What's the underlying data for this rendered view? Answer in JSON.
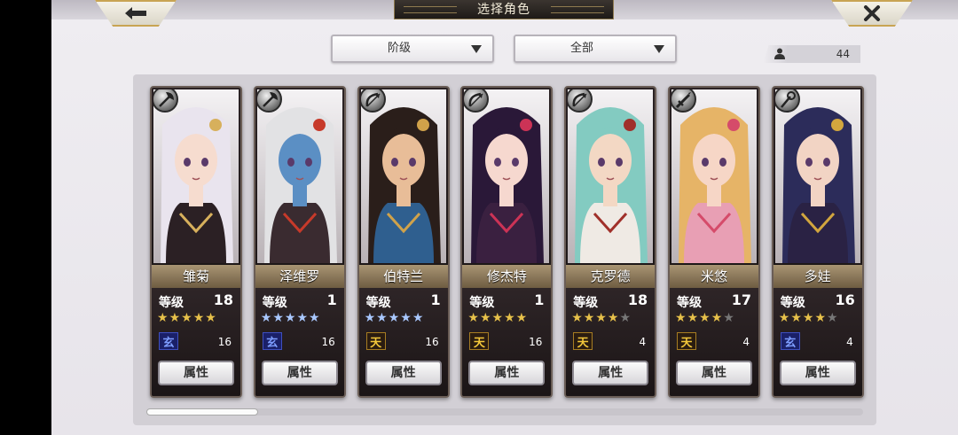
{
  "header": {
    "title": "选择角色",
    "back_icon": "back-arrow-icon",
    "close_icon": "close-icon"
  },
  "filters": {
    "class_dropdown": "阶级",
    "all_dropdown": "全部"
  },
  "character_count": "44",
  "level_label": "等级",
  "attribute_label": "属性",
  "colors": {
    "gold_star": "#e7c14a",
    "blue_star": "#a9c8ff",
    "gray_star": "#777777",
    "frame": "#6a5d56"
  },
  "characters": [
    {
      "name": "雏菊",
      "level": "18",
      "stars": [
        "gold",
        "gold",
        "gold",
        "gold",
        "gold"
      ],
      "rank": "blue",
      "rank_num": "16",
      "weapon": "axe-icon",
      "hair": "#e9e4ee",
      "skin": "#f6dccf",
      "cloth": "#2b2024",
      "accent": "#d7b05c"
    },
    {
      "name": "泽维罗",
      "level": "1",
      "stars": [
        "blue",
        "blue",
        "blue",
        "blue",
        "blue"
      ],
      "rank": "blue",
      "rank_num": "16",
      "weapon": "axe-icon",
      "hair": "#e2e2e4",
      "skin": "#5b8fc4",
      "cloth": "#3a2b30",
      "accent": "#c73a2a"
    },
    {
      "name": "伯特兰",
      "level": "1",
      "stars": [
        "blue",
        "blue",
        "blue",
        "blue",
        "blue"
      ],
      "rank": "gold",
      "rank_num": "16",
      "weapon": "bow-icon",
      "hair": "#2a1e1a",
      "skin": "#e8bd98",
      "cloth": "#2f5f8f",
      "accent": "#d0a24a"
    },
    {
      "name": "修杰特",
      "level": "1",
      "stars": [
        "gold",
        "gold",
        "gold",
        "gold",
        "gold"
      ],
      "rank": "gold",
      "rank_num": "16",
      "weapon": "bow-icon",
      "hair": "#2a1838",
      "skin": "#f6d8cf",
      "cloth": "#3a2040",
      "accent": "#cc3356"
    },
    {
      "name": "克罗德",
      "level": "18",
      "stars": [
        "gold",
        "gold",
        "gold",
        "gold",
        "gray"
      ],
      "rank": "gold",
      "rank_num": "4",
      "weapon": "bow-icon",
      "hair": "#83cbc1",
      "skin": "#f3d8c4",
      "cloth": "#efeae4",
      "accent": "#a0302a"
    },
    {
      "name": "米悠",
      "level": "17",
      "stars": [
        "gold",
        "gold",
        "gold",
        "gold",
        "gray"
      ],
      "rank": "gold",
      "rank_num": "4",
      "weapon": "sword-icon",
      "hair": "#e6b467",
      "skin": "#f6d6c6",
      "cloth": "#e89fb4",
      "accent": "#d54b6a"
    },
    {
      "name": "多娃",
      "level": "16",
      "stars": [
        "gold",
        "gold",
        "gold",
        "gold",
        "gray"
      ],
      "rank": "blue",
      "rank_num": "4",
      "weapon": "staff-icon",
      "hair": "#2c2c5a",
      "skin": "#f2d4c4",
      "cloth": "#2a2244",
      "accent": "#d2a63e"
    }
  ]
}
